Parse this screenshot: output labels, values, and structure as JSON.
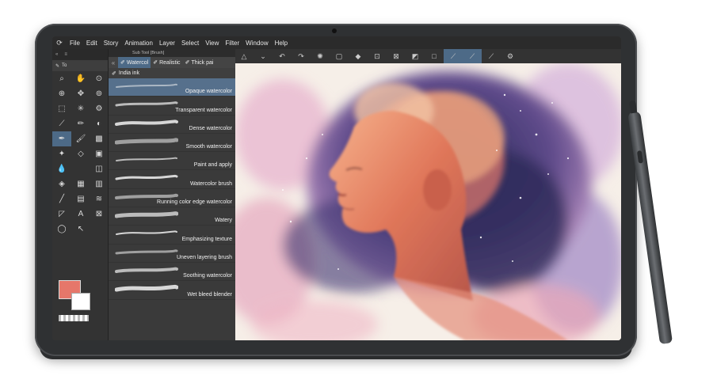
{
  "menu": [
    "File",
    "Edit",
    "Story",
    "Animation",
    "Layer",
    "Select",
    "View",
    "Filter",
    "Window",
    "Help"
  ],
  "toolbar": {
    "tab_label": "To"
  },
  "subtool": {
    "title": "Sub Tool [Brush]",
    "tabs": [
      "Watercol",
      "Realistic",
      "Thick pai"
    ],
    "tab2": "India ink",
    "brushes": [
      "Opaque watercolor",
      "Transparent watercolor",
      "Dense watercolor",
      "Smooth watercolor",
      "Paint and apply",
      "Watercolor brush",
      "Running color edge watercolor",
      "Watery",
      "Emphasizing texture",
      "Uneven layering brush",
      "Soothing watercolor",
      "Wet bleed blender"
    ],
    "selected_index": 0
  },
  "colors": {
    "main": "#e6776a",
    "sub": "#ffffff",
    "accent": "#4d6a87"
  },
  "icons": {
    "tools": [
      "search-icon",
      "hand-icon",
      "move-icon",
      "move-layer-icon",
      "select-rect-icon",
      "magic-wand-icon",
      "eyedropper-icon",
      "pen-icon",
      "pencil-icon",
      "brush-icon",
      "airbrush-icon",
      "decoration-icon",
      "eraser-icon",
      "blend-icon",
      "fill-icon",
      "gradient-icon",
      "figure-icon",
      "frame-icon",
      "ruler-icon",
      "text-icon",
      "balloon-icon",
      "correct-line-icon"
    ]
  }
}
